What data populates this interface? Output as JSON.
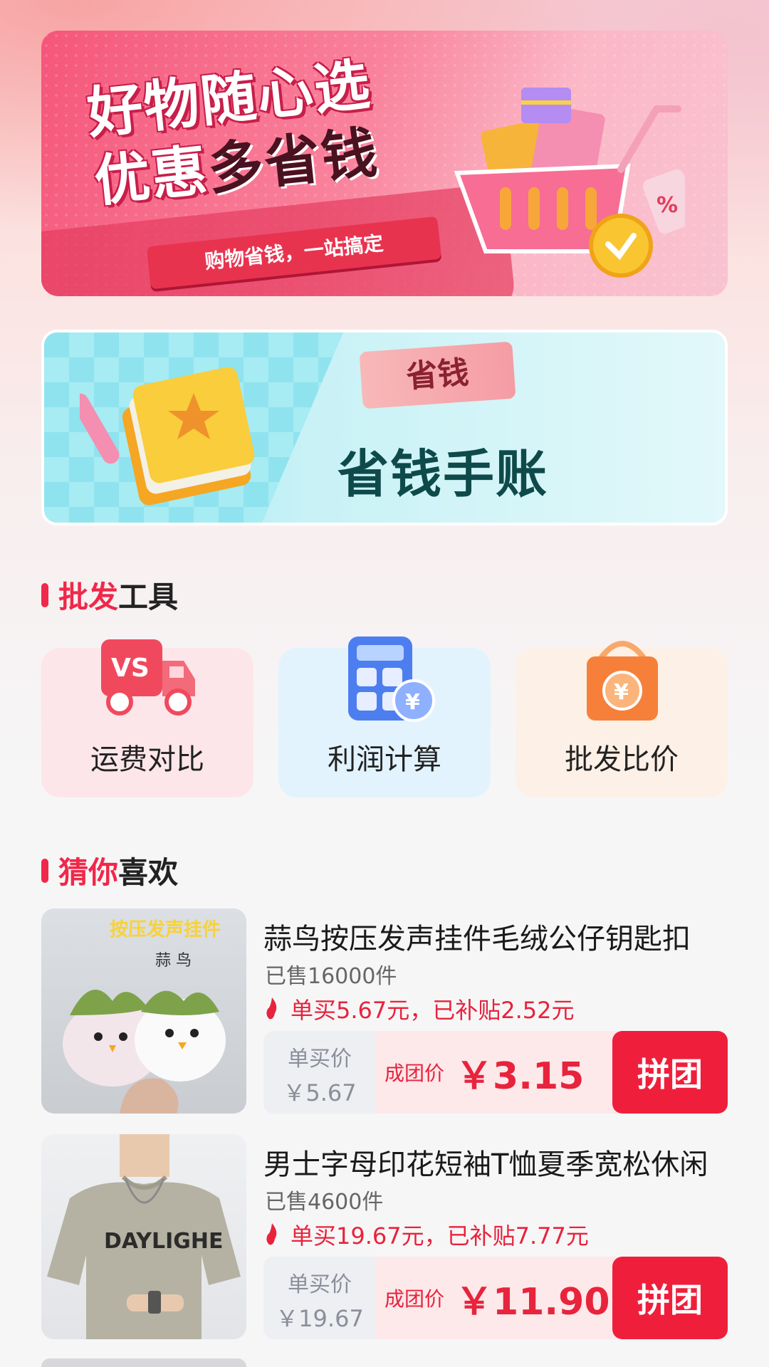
{
  "hero": {
    "title_line1": "好物随心选",
    "title_line2_accent": "优惠",
    "title_line2_dark": "多省钱",
    "subtitle": "购物省钱，一站搞定",
    "percent_tag": "%"
  },
  "save_banner": {
    "tag": "省钱",
    "title": "省钱手账"
  },
  "tools_section": {
    "accent": "批发",
    "rest": "工具",
    "items": [
      {
        "label": "运费对比",
        "icon_text": "VS",
        "bg": "#fde6ea"
      },
      {
        "label": "利润计算",
        "icon_text": "¥",
        "bg": "#e3f3fd"
      },
      {
        "label": "批发比价",
        "icon_text": "¥",
        "bg": "#fdf0e6"
      }
    ]
  },
  "recommend_section": {
    "accent": "猜你",
    "rest": "喜欢"
  },
  "products": [
    {
      "title": "蒜鸟按压发声挂件毛绒公仔钥匙扣",
      "sold": "已售16000件",
      "subsidy": "单买5.67元，已补贴2.52元",
      "single_label": "单买价",
      "single_price": "￥5.67",
      "group_label": "成团价",
      "group_price": "￥3.15",
      "button": "拼团",
      "thumb_caption": "按压发声挂件",
      "thumb_caption2": "蒜 鸟"
    },
    {
      "title": "男士字母印花短袖T恤夏季宽松休闲",
      "sold": "已售4600件",
      "subsidy": "单买19.67元，已补贴7.77元",
      "single_label": "单买价",
      "single_price": "￥19.67",
      "group_label": "成团价",
      "group_price": "￥11.90",
      "button": "拼团",
      "thumb_caption": "DAYLIGHE"
    }
  ],
  "colors": {
    "accent": "#f0284a",
    "price_red": "#e8233c",
    "button_red": "#ef1f3b"
  }
}
